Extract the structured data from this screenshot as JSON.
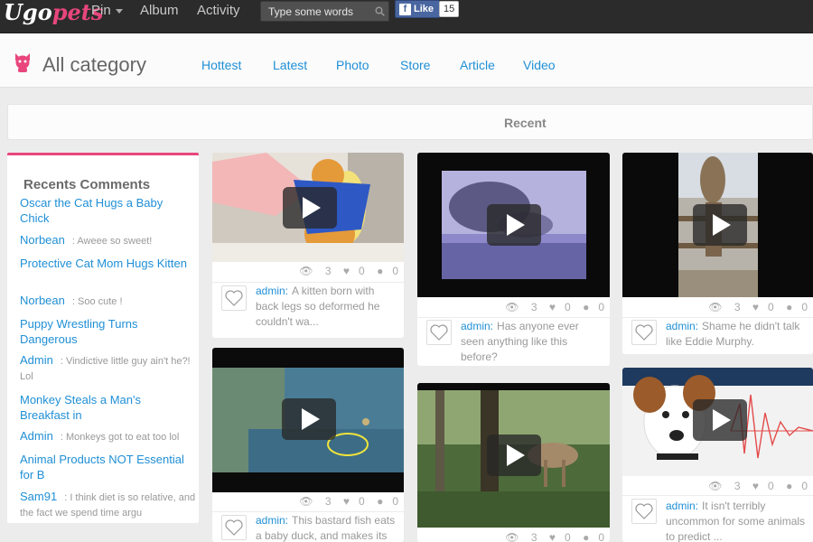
{
  "topbar": {
    "logo_part1": "Ugo",
    "logo_part2": "pets",
    "nav": [
      "Pin",
      "Album",
      "Activity"
    ],
    "search_placeholder": "Type some words",
    "fb_like_label": "Like",
    "fb_count": "15"
  },
  "category": {
    "title": "All category",
    "tabs": [
      "Hottest",
      "Latest",
      "Photo",
      "Store",
      "Article",
      "Video"
    ]
  },
  "recent_label": "Recent",
  "comments": {
    "heading": "Recents Comments",
    "items": [
      {
        "title": "Oscar the Cat Hugs a Baby Chick",
        "author": "Norbean",
        "text": ": Aweee so sweet!"
      },
      {
        "title": "Protective Cat Mom Hugs Kitten",
        "author": "Norbean",
        "text": ": Soo cute !"
      },
      {
        "title": "Puppy Wrestling Turns Dangerous",
        "author": "Admin",
        "text": ": Vindictive little guy ain't he?! Lol"
      },
      {
        "title": "Monkey Steals a Man's Breakfast in",
        "author": "Admin",
        "text": ": Monkeys got to eat too lol"
      },
      {
        "title": "Animal Products NOT Essential for B",
        "author": "Sam91",
        "text": ": I think diet is so relative, and the fact we spend time argu"
      }
    ]
  },
  "cards": [
    {
      "views": "3",
      "likes": "0",
      "comments": "0",
      "author": "admin:",
      "caption": "A kitten born with back legs so deformed he couldn't wa..."
    },
    {
      "views": "3",
      "likes": "0",
      "comments": "0",
      "author": "admin:",
      "caption": "This bastard fish eats a baby duck, and makes its"
    },
    {
      "views": "3",
      "likes": "0",
      "comments": "0",
      "author": "admin:",
      "caption": "Has anyone ever seen anything like this before?"
    },
    {
      "views": "3",
      "likes": "0",
      "comments": "0",
      "author": "",
      "caption": ""
    },
    {
      "views": "3",
      "likes": "0",
      "comments": "0",
      "author": "admin:",
      "caption": "Shame he didn't talk like Eddie Murphy."
    },
    {
      "views": "3",
      "likes": "0",
      "comments": "0",
      "author": "admin:",
      "caption": "It isn't terribly uncommon for some animals to predict ..."
    }
  ],
  "colors": {
    "accent_pink": "#e8467c",
    "link_blue": "#1f8fd6",
    "topbar_bg": "#2b2b2b"
  }
}
